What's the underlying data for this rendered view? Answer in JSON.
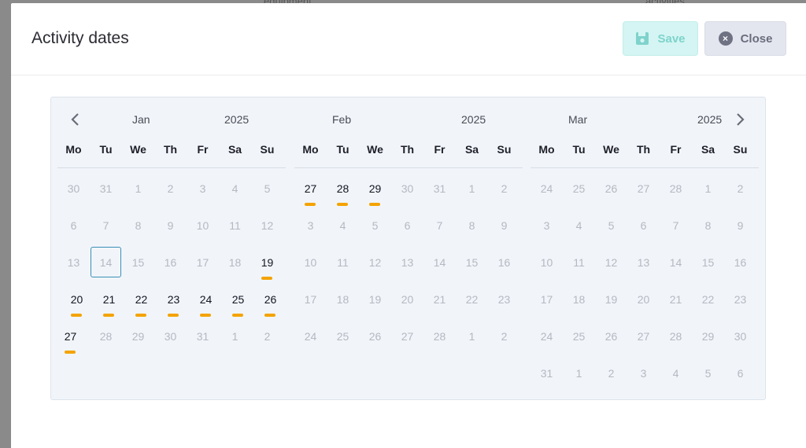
{
  "background": {
    "text_left": "equipment",
    "text_right": "activities"
  },
  "modal": {
    "title": "Activity dates",
    "save_label": "Save",
    "close_label": "Close"
  },
  "calendar": {
    "accent_color": "#f4a300",
    "weekdays": [
      "Mo",
      "Tu",
      "We",
      "Th",
      "Fr",
      "Sa",
      "Su"
    ],
    "months": [
      {
        "name": "Jan",
        "year": "2025",
        "days": [
          "30",
          "31",
          "1",
          "2",
          "3",
          "4",
          "5",
          "6",
          "7",
          "8",
          "9",
          "10",
          "11",
          "12",
          "13",
          "14",
          "15",
          "16",
          "17",
          "18",
          "19",
          "20",
          "21",
          "22",
          "23",
          "24",
          "25",
          "26",
          "27",
          "28",
          "29",
          "30",
          "31",
          "1",
          "2"
        ],
        "in_month_start": 2,
        "in_month_end": 32,
        "marked": [
          20,
          21,
          22,
          23,
          24,
          25,
          26,
          27,
          28
        ],
        "today_index": 15
      },
      {
        "name": "Feb",
        "year": "2025",
        "days": [
          "27",
          "28",
          "29",
          "30",
          "31",
          "1",
          "2",
          "3",
          "4",
          "5",
          "6",
          "7",
          "8",
          "9",
          "10",
          "11",
          "12",
          "13",
          "14",
          "15",
          "16",
          "17",
          "18",
          "19",
          "20",
          "21",
          "22",
          "23",
          "24",
          "25",
          "26",
          "27",
          "28",
          "1",
          "2"
        ],
        "in_month_start": 5,
        "in_month_end": 32,
        "marked": [
          0,
          1,
          2
        ],
        "today_index": -1
      },
      {
        "name": "Mar",
        "year": "2025",
        "days": [
          "24",
          "25",
          "26",
          "27",
          "28",
          "1",
          "2",
          "3",
          "4",
          "5",
          "6",
          "7",
          "8",
          "9",
          "10",
          "11",
          "12",
          "13",
          "14",
          "15",
          "16",
          "17",
          "18",
          "19",
          "20",
          "21",
          "22",
          "23",
          "24",
          "25",
          "26",
          "27",
          "28",
          "29",
          "30",
          "31",
          "1",
          "2",
          "3",
          "4",
          "5",
          "6"
        ],
        "in_month_start": 5,
        "in_month_end": 35,
        "marked": [],
        "today_index": -1
      }
    ]
  }
}
